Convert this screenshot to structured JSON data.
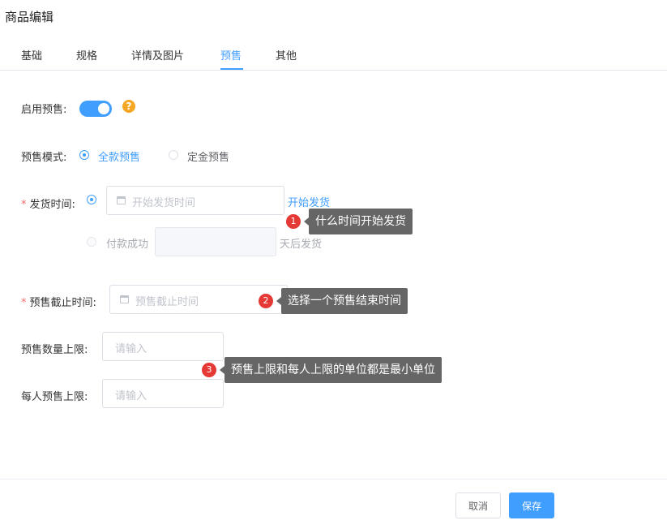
{
  "page": {
    "title": "商品编辑"
  },
  "tabs": [
    {
      "label": "基础"
    },
    {
      "label": "规格"
    },
    {
      "label": "详情及图片"
    },
    {
      "label": "预售",
      "active": true
    },
    {
      "label": "其他"
    }
  ],
  "form": {
    "presale_toggle": {
      "label": "启用预售:",
      "enabled": true,
      "help_icon": "question-icon"
    },
    "presale_mode": {
      "label": "预售模式:",
      "options": [
        "全款预售",
        "定金预售"
      ],
      "selected": "全款预售"
    },
    "ship_time": {
      "label": "发货时间:",
      "start_placeholder": "开始发货时间",
      "start_suffix": "开始发货",
      "after_pay_label": "付款成功",
      "after_pay_suffix": "天后发货"
    },
    "presale_end": {
      "label": "预售截止时间:",
      "placeholder": "预售截止时间"
    },
    "qty_limit": {
      "label": "预售数量上限:",
      "placeholder": "请输入"
    },
    "per_user_limit": {
      "label": "每人预售上限:",
      "placeholder": "请输入"
    }
  },
  "annotations": [
    {
      "number": "1",
      "text": "什么时间开始发货"
    },
    {
      "number": "2",
      "text": "选择一个预售结束时间"
    },
    {
      "number": "3",
      "text": "预售上限和每人上限的单位都是最小单位"
    }
  ],
  "footer": {
    "cancel_label": "取消",
    "save_label": "保存"
  },
  "colors": {
    "accent": "#409eff",
    "required": "#f56c6c",
    "help": "#f5a623",
    "badge": "#e53935",
    "tooltip": "#666666"
  }
}
